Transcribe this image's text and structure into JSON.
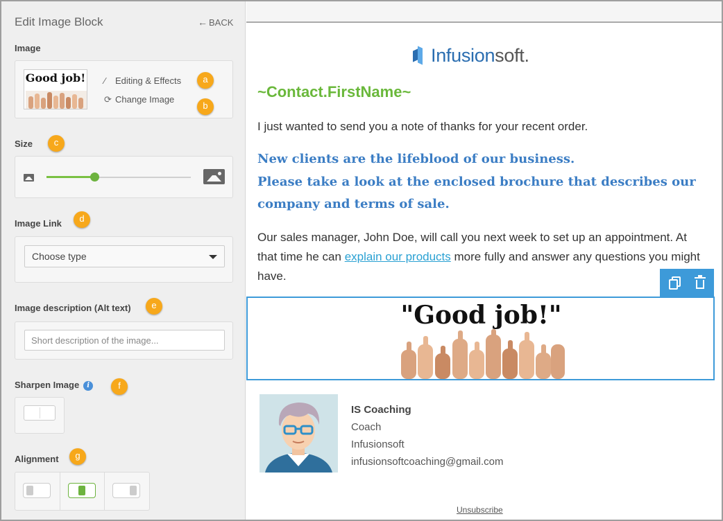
{
  "panel": {
    "title": "Edit Image Block",
    "back_label": "BACK",
    "image": {
      "label": "Image",
      "thumb_text": "Good job!",
      "editing_label": "Editing & Effects",
      "change_label": "Change Image",
      "marker_a": "a",
      "marker_b": "b"
    },
    "size": {
      "label": "Size",
      "marker": "c",
      "slider_value": 0.33
    },
    "image_link": {
      "label": "Image Link",
      "marker": "d",
      "selected": "Choose type"
    },
    "alt_text": {
      "label": "Image description (Alt text)",
      "marker": "e",
      "placeholder": "Short description of the image..."
    },
    "sharpen": {
      "label": "Sharpen Image",
      "marker": "f",
      "enabled": false
    },
    "alignment": {
      "label": "Alignment",
      "marker": "g",
      "selected": "center"
    }
  },
  "email": {
    "logo": {
      "part1": "Infusion",
      "part2": "soft."
    },
    "contact_field": "~Contact.FirstName~",
    "para1": "I just wanted to send you a note of thanks for your recent order.",
    "headline_lines": [
      "New clients are the lifeblood of our business.",
      "Please take a look at the enclosed brochure that describes our",
      "company and terms of sale."
    ],
    "para2_before": "Our sales manager, John Doe, will call you next week to set up an appointment. At that time he can ",
    "para2_link": "explain our products",
    "para2_after": " more fully and answer any questions you might have.",
    "image_text": "\"Good job!\"",
    "signature": {
      "name": "IS Coaching",
      "title": "Coach",
      "company": "Infusionsoft",
      "email": "infusionsoftcoaching@gmail.com"
    },
    "unsubscribe": "Unsubscribe"
  },
  "colors": {
    "accent_green": "#6db33f",
    "marker_orange": "#f7a81b",
    "headline_blue": "#3b7dc4",
    "select_blue": "#3d9ad9",
    "link_blue": "#2aa1d3"
  }
}
